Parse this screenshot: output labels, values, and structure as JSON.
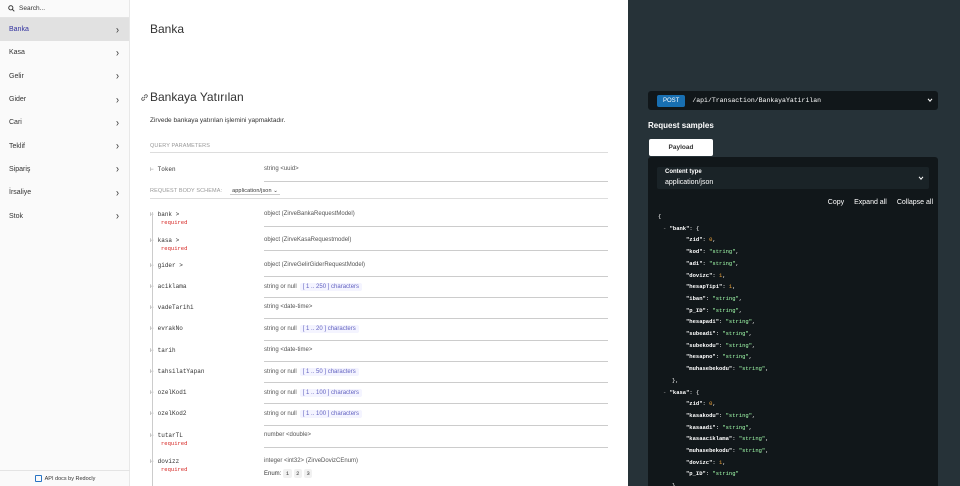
{
  "search": {
    "placeholder": "Search..."
  },
  "sidebar": {
    "items": [
      {
        "label": "Banka",
        "active": true
      },
      {
        "label": "Kasa"
      },
      {
        "label": "Gelir"
      },
      {
        "label": "Gider"
      },
      {
        "label": "Cari"
      },
      {
        "label": "Teklif"
      },
      {
        "label": "Sipariş"
      },
      {
        "label": "İrsaliye"
      },
      {
        "label": "Stok"
      }
    ],
    "footer": "API docs by Redocly"
  },
  "main": {
    "section_title": "Banka",
    "operation_title": "Bankaya Yatırılan",
    "description": "Zirvede bankaya yatırılan işlemini yapmaktadır.",
    "query_label": "QUERY PARAMETERS",
    "query_params": [
      {
        "name": "Token",
        "type": "string <uuid>"
      }
    ],
    "body_label": "REQUEST BODY SCHEMA:",
    "content_type": "application/json",
    "body_params": [
      {
        "name": "bank >",
        "required": "required",
        "type": "object (ZirveBankaRequestModel)"
      },
      {
        "name": "kasa >",
        "required": "required",
        "type": "object (ZirveKasaRequestmodel)"
      },
      {
        "name": "gider >",
        "type": "object (ZirveGelirGiderRequestModel)"
      },
      {
        "name": "aciklama",
        "type": "string or null",
        "range": "[ 1 .. 250 ] characters"
      },
      {
        "name": "vadeTarihi",
        "type": "string <date-time>"
      },
      {
        "name": "evrakNo",
        "type": "string or null",
        "range": "[ 1 .. 20 ] characters"
      },
      {
        "name": "tarih",
        "type": "string <date-time>"
      },
      {
        "name": "tahsilatYapan",
        "type": "string or null",
        "range": "[ 1 .. 50 ] characters"
      },
      {
        "name": "ozelKod1",
        "type": "string or null",
        "range": "[ 1 .. 100 ] characters"
      },
      {
        "name": "ozelKod2",
        "type": "string or null",
        "range": "[ 1 .. 100 ] characters"
      },
      {
        "name": "tutarTL",
        "required": "required",
        "type": "number <double>"
      },
      {
        "name": "dovizz",
        "required": "required",
        "type": "integer <int32> (ZirveDovizCEnum)",
        "enum_label": "Enum:",
        "enum": [
          "1",
          "2",
          "3"
        ]
      }
    ]
  },
  "right": {
    "method": "post",
    "path": "/api/Transaction/BankayaYatirilan",
    "samples_title": "Request samples",
    "payload_tab": "Payload",
    "content_type_label": "Content type",
    "content_type_value": "application/json",
    "copy": "Copy",
    "expand_all": "Expand all",
    "collapse_all": "Collapse all",
    "bank_key": "\"bank\"",
    "bank_fields": [
      {
        "k": "\"zid\"",
        "v": "0",
        "t": "n"
      },
      {
        "k": "\"kod\"",
        "v": "\"string\"",
        "t": "s"
      },
      {
        "k": "\"adi\"",
        "v": "\"string\"",
        "t": "s"
      },
      {
        "k": "\"dovizc\"",
        "v": "1",
        "t": "n"
      },
      {
        "k": "\"hesapTipi\"",
        "v": "1",
        "t": "n"
      },
      {
        "k": "\"iban\"",
        "v": "\"string\"",
        "t": "s"
      },
      {
        "k": "\"p_ID\"",
        "v": "\"string\"",
        "t": "s"
      },
      {
        "k": "\"hesapadi\"",
        "v": "\"string\"",
        "t": "s"
      },
      {
        "k": "\"subeadi\"",
        "v": "\"string\"",
        "t": "s"
      },
      {
        "k": "\"subekodu\"",
        "v": "\"string\"",
        "t": "s"
      },
      {
        "k": "\"hesapno\"",
        "v": "\"string\"",
        "t": "s"
      },
      {
        "k": "\"muhasebekodu\"",
        "v": "\"string\"",
        "t": "s"
      }
    ],
    "kasa_key": "\"kasa\"",
    "kasa_fields": [
      {
        "k": "\"zid\"",
        "v": "0",
        "t": "n"
      },
      {
        "k": "\"kasakodu\"",
        "v": "\"string\"",
        "t": "s"
      },
      {
        "k": "\"kasaadi\"",
        "v": "\"string\"",
        "t": "s"
      },
      {
        "k": "\"kasaaciklama\"",
        "v": "\"string\"",
        "t": "s"
      },
      {
        "k": "\"muhasebekodu\"",
        "v": "\"string\"",
        "t": "s"
      },
      {
        "k": "\"dovizc\"",
        "v": "1",
        "t": "n"
      },
      {
        "k": "\"p_ID\"",
        "v": "\"string\"",
        "t": "s"
      }
    ]
  },
  "colors": {
    "active_nav": "#32329f",
    "required": "#d41f1c",
    "right_panel": "#263238",
    "post_badge": "#186fb1",
    "code_string": "#a0fbaa",
    "code_number": "#f3a53a"
  }
}
